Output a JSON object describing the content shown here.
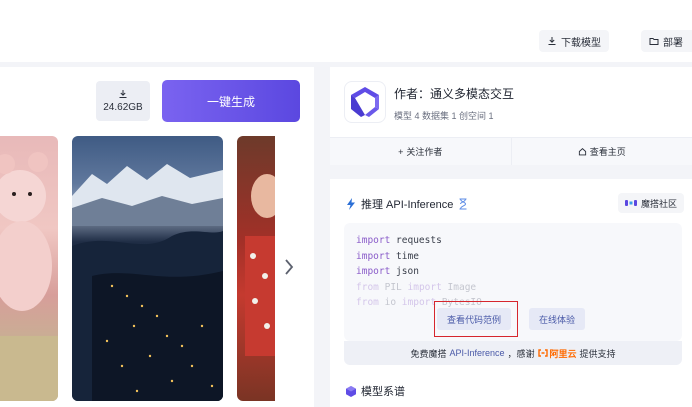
{
  "topbar": {
    "download_model_label": "下载模型",
    "deploy_label": "部署"
  },
  "left": {
    "download_size": "24.62GB",
    "generate_label": "一键生成"
  },
  "author": {
    "name": "作者：通义多模态交互",
    "stats": "模型 4  数据集 1  创空间 1",
    "follow_label": "关注作者",
    "homepage_label": "查看主页"
  },
  "inference": {
    "title": "推理 API-Inference",
    "community_label": "魔搭社区",
    "code_lines": [
      {
        "kw": "import",
        "rest": " requests"
      },
      {
        "kw": "import",
        "rest": " time"
      },
      {
        "kw": "import",
        "rest": " json"
      },
      {
        "kw": "from",
        "rest": " PIL ",
        "kw2": "import",
        "rest2": " Image"
      },
      {
        "kw": "from",
        "rest": " io ",
        "kw2": "import",
        "rest2": " BytesIO"
      }
    ],
    "view_code_label": "查看代码范例",
    "try_online_label": "在线体验",
    "support_prefix": "免费魔搭",
    "support_link": "API-Inference",
    "support_mid": "，感谢",
    "support_brand": "阿里云",
    "support_suffix": "提供支持"
  },
  "lineage": {
    "title": "模型系谱"
  },
  "colors": {
    "accent": "#5b48e0",
    "highlight": "#d6262d",
    "aliyun": "#ff6a00"
  }
}
